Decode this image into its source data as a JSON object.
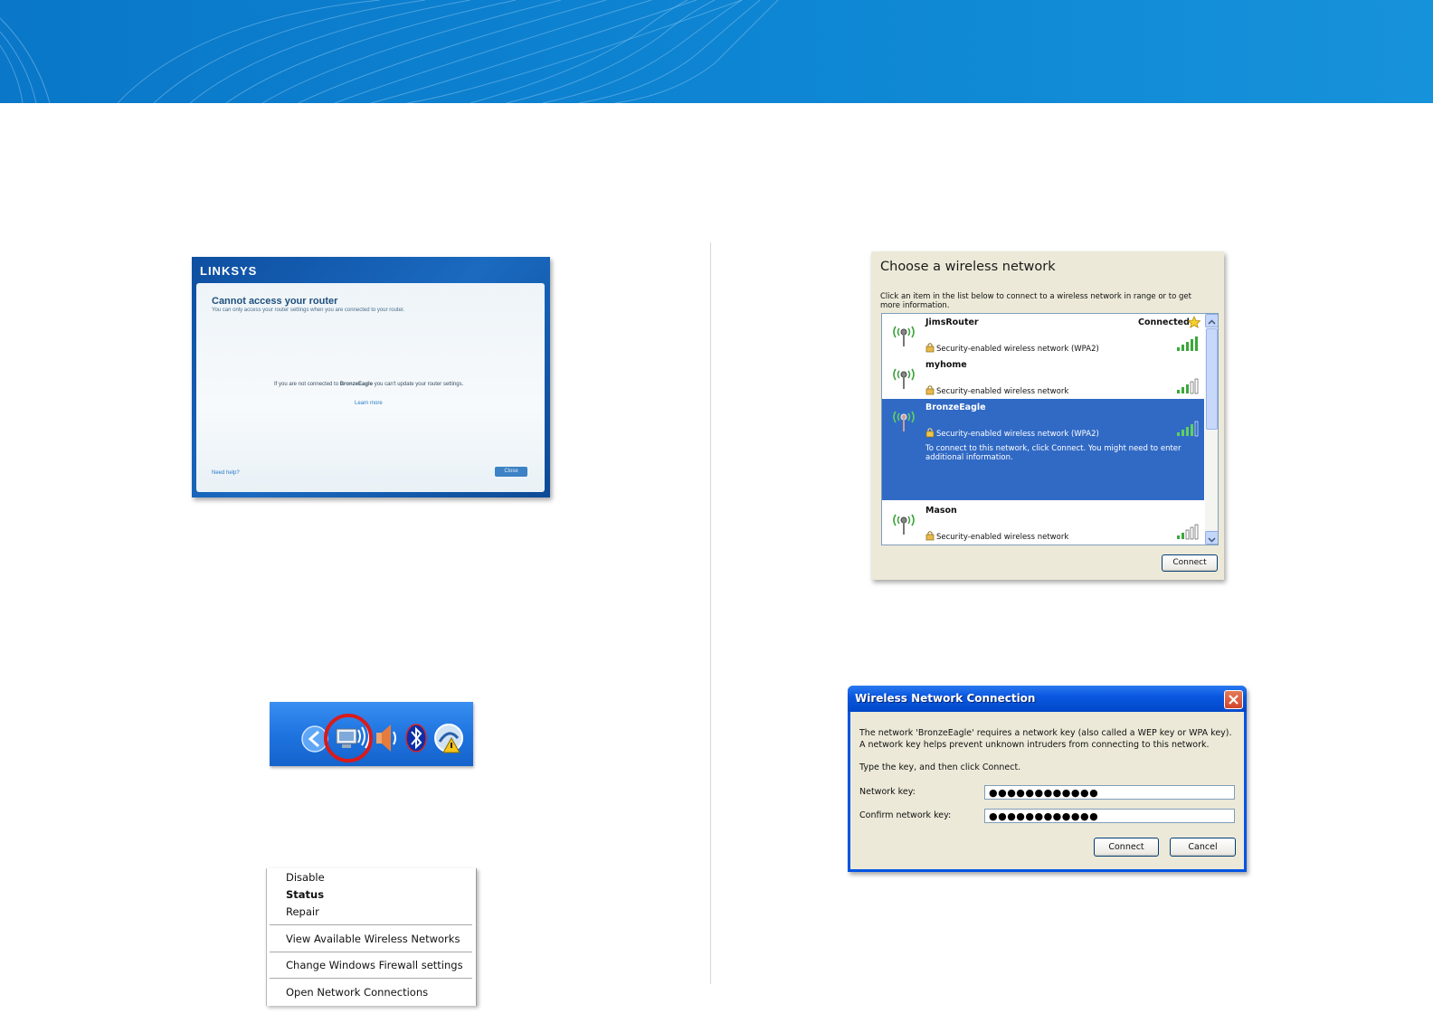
{
  "colors": {
    "banner": "#0e86d3",
    "xp_title_blue": "#0054e3",
    "selection_blue": "#316ac5",
    "tray_highlight": "#d81b1b"
  },
  "linksys_panel": {
    "logo": "LINKSYS",
    "title": "Cannot access your router",
    "subtitle": "You can only access your router settings when you are connected to your router.",
    "message_before": "If you are not connected to ",
    "network": "BronzeEagle",
    "message_after": " you can't update your router settings.",
    "learn_more": "Learn more",
    "need_help": "Need help?",
    "close_button": "Close"
  },
  "tray": {
    "icons": [
      "chevron-left-icon",
      "wireless-network-icon",
      "speaker-icon",
      "bluetooth-icon",
      "security-alert-icon"
    ],
    "highlighted": "wireless-network-icon"
  },
  "context_menu": {
    "items": [
      {
        "label": "Disable"
      },
      {
        "label": "Status"
      },
      {
        "label": "Repair"
      },
      {
        "label": "View Available Wireless Networks"
      },
      {
        "label": "Change Windows Firewall settings"
      },
      {
        "label": "Open Network Connections"
      }
    ]
  },
  "choose_network": {
    "title": "Choose a wireless network",
    "instructions": "Click an item in the list below to connect to a wireless network in range or to get more information.",
    "networks": [
      {
        "name": "JimsRouter",
        "security": "Security-enabled wireless network (WPA2)",
        "status": "Connected"
      },
      {
        "name": "myhome",
        "security": "Security-enabled wireless network"
      },
      {
        "name": "BronzeEagle",
        "security": "Security-enabled wireless network (WPA2)",
        "hint": "To connect to this network, click Connect. You might need to enter additional information."
      },
      {
        "name": "Mason",
        "security": "Security-enabled wireless network"
      }
    ],
    "connect_button": "Connect"
  },
  "key_dialog": {
    "title": "Wireless Network Connection",
    "message": "The network 'BronzeEagle' requires a network key (also called a WEP key or WPA key). A network key helps prevent unknown intruders from connecting to this network.",
    "prompt": "Type the key, and then click Connect.",
    "network_key_label": "Network key:",
    "network_key_value": "●●●●●●●●●●●●",
    "confirm_key_label": "Confirm network key:",
    "confirm_key_value": "●●●●●●●●●●●●",
    "connect_button": "Connect",
    "cancel_button": "Cancel"
  }
}
